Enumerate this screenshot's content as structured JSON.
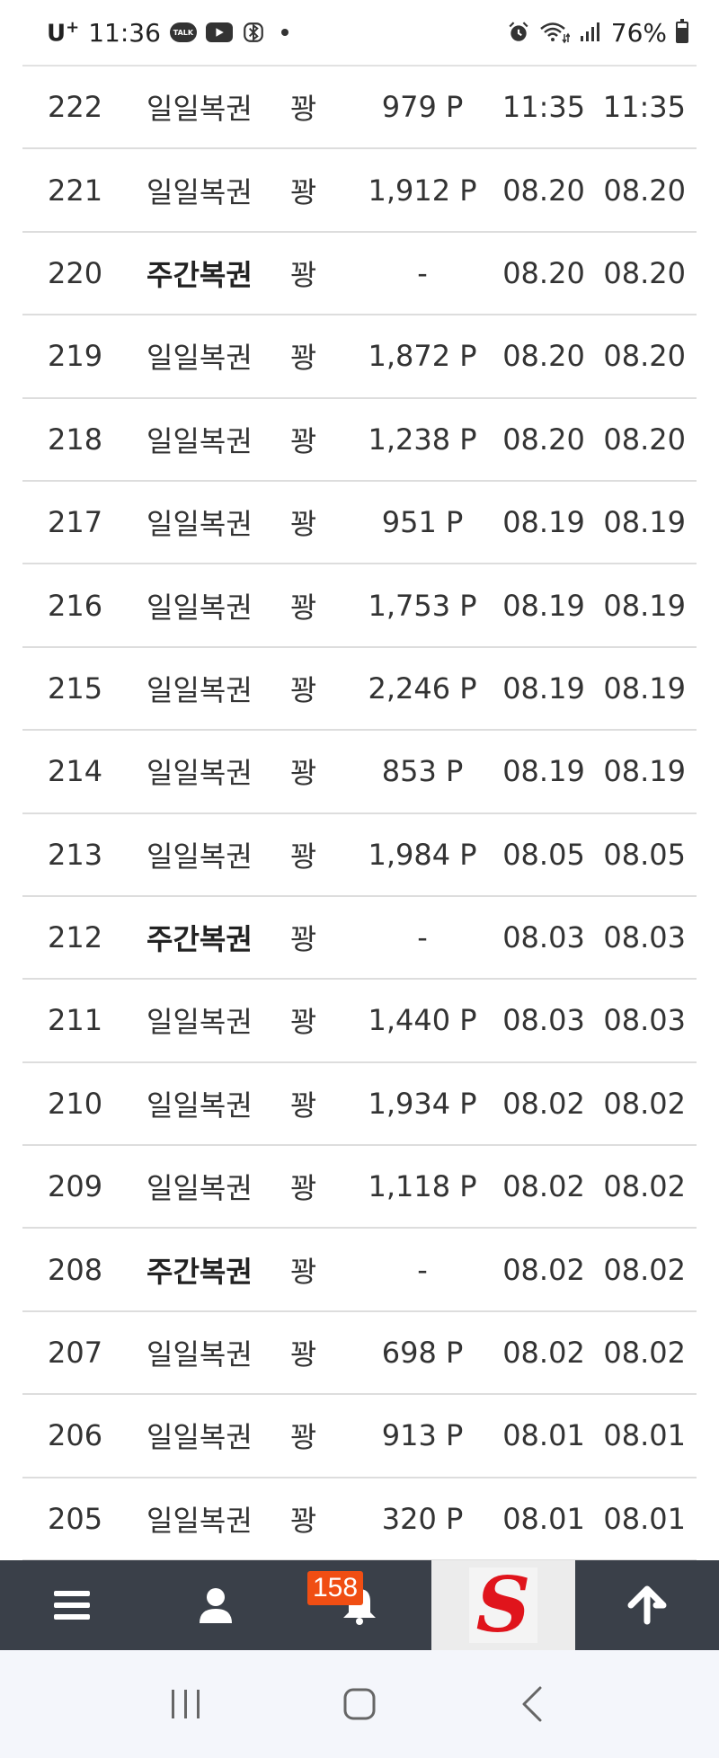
{
  "status_bar": {
    "carrier": "U",
    "carrier_plus": "+",
    "time": "11:36",
    "talk_label": "TALK",
    "battery": "76%",
    "icons": [
      "talk-icon",
      "youtube-icon",
      "bluetooth-icon",
      "alarm-icon",
      "wifi-icon",
      "signal-icon",
      "battery-icon"
    ]
  },
  "rows": [
    {
      "no": "222",
      "type": "일일복권",
      "bold": false,
      "result": "꽝",
      "points": "979 P",
      "date1": "11:35",
      "date2": "11:35"
    },
    {
      "no": "221",
      "type": "일일복권",
      "bold": false,
      "result": "꽝",
      "points": "1,912 P",
      "date1": "08.20",
      "date2": "08.20"
    },
    {
      "no": "220",
      "type": "주간복권",
      "bold": true,
      "result": "꽝",
      "points": "-",
      "date1": "08.20",
      "date2": "08.20"
    },
    {
      "no": "219",
      "type": "일일복권",
      "bold": false,
      "result": "꽝",
      "points": "1,872 P",
      "date1": "08.20",
      "date2": "08.20"
    },
    {
      "no": "218",
      "type": "일일복권",
      "bold": false,
      "result": "꽝",
      "points": "1,238 P",
      "date1": "08.20",
      "date2": "08.20"
    },
    {
      "no": "217",
      "type": "일일복권",
      "bold": false,
      "result": "꽝",
      "points": "951 P",
      "date1": "08.19",
      "date2": "08.19"
    },
    {
      "no": "216",
      "type": "일일복권",
      "bold": false,
      "result": "꽝",
      "points": "1,753 P",
      "date1": "08.19",
      "date2": "08.19"
    },
    {
      "no": "215",
      "type": "일일복권",
      "bold": false,
      "result": "꽝",
      "points": "2,246 P",
      "date1": "08.19",
      "date2": "08.19"
    },
    {
      "no": "214",
      "type": "일일복권",
      "bold": false,
      "result": "꽝",
      "points": "853 P",
      "date1": "08.19",
      "date2": "08.19"
    },
    {
      "no": "213",
      "type": "일일복권",
      "bold": false,
      "result": "꽝",
      "points": "1,984 P",
      "date1": "08.05",
      "date2": "08.05"
    },
    {
      "no": "212",
      "type": "주간복권",
      "bold": true,
      "result": "꽝",
      "points": "-",
      "date1": "08.03",
      "date2": "08.03"
    },
    {
      "no": "211",
      "type": "일일복권",
      "bold": false,
      "result": "꽝",
      "points": "1,440 P",
      "date1": "08.03",
      "date2": "08.03"
    },
    {
      "no": "210",
      "type": "일일복권",
      "bold": false,
      "result": "꽝",
      "points": "1,934 P",
      "date1": "08.02",
      "date2": "08.02"
    },
    {
      "no": "209",
      "type": "일일복권",
      "bold": false,
      "result": "꽝",
      "points": "1,118 P",
      "date1": "08.02",
      "date2": "08.02"
    },
    {
      "no": "208",
      "type": "주간복권",
      "bold": true,
      "result": "꽝",
      "points": "-",
      "date1": "08.02",
      "date2": "08.02"
    },
    {
      "no": "207",
      "type": "일일복권",
      "bold": false,
      "result": "꽝",
      "points": "698 P",
      "date1": "08.02",
      "date2": "08.02"
    },
    {
      "no": "206",
      "type": "일일복권",
      "bold": false,
      "result": "꽝",
      "points": "913 P",
      "date1": "08.01",
      "date2": "08.01"
    },
    {
      "no": "205",
      "type": "일일복권",
      "bold": false,
      "result": "꽝",
      "points": "320 P",
      "date1": "08.01",
      "date2": "08.01"
    }
  ],
  "bottom_nav": {
    "items": [
      "menu-icon",
      "user-icon",
      "bell-icon",
      "site-logo",
      "arrow-up-icon"
    ],
    "notification_count": "158",
    "logo_letter": "S",
    "background": "#3a4049",
    "badge_color": "#f04e13",
    "logo_color": "#e0141c"
  },
  "system_nav": {
    "items": [
      "recent-apps-icon",
      "home-icon",
      "back-icon"
    ]
  }
}
